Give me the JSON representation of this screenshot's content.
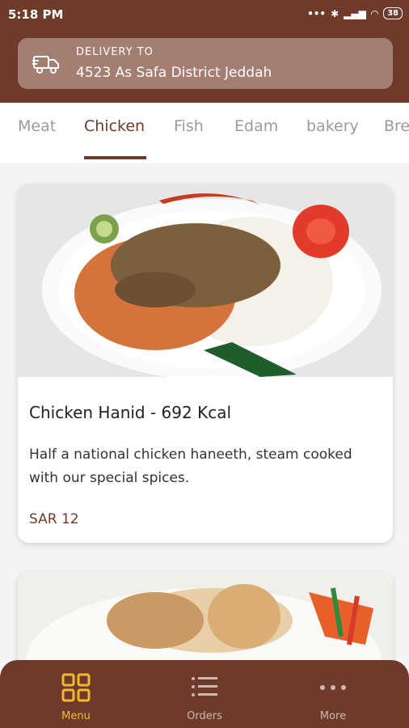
{
  "status_bar": {
    "time": "5:18 PM",
    "battery": "38"
  },
  "delivery": {
    "label": "DELIVERY TO",
    "address": "4523 As Safa District Jeddah"
  },
  "tabs": [
    "Meat",
    "Chicken",
    "Fish",
    "Edam",
    "bakery",
    "Bre"
  ],
  "selected_tab": "Chicken",
  "items": [
    {
      "title": "Chicken Hanid - 692 Kcal",
      "description": "Half a national chicken haneeth, steam cooked with our special spices.",
      "price": "SAR 12"
    }
  ],
  "bottom_nav": [
    {
      "label": "Menu",
      "icon": "grid-icon",
      "active": true
    },
    {
      "label": "Orders",
      "icon": "list-icon",
      "active": false
    },
    {
      "label": "More",
      "icon": "more-dots-icon",
      "active": false
    }
  ],
  "colors": {
    "brand": "#6e3b2b",
    "accent": "#f3b833",
    "delivery_bg": "#a57e73"
  }
}
